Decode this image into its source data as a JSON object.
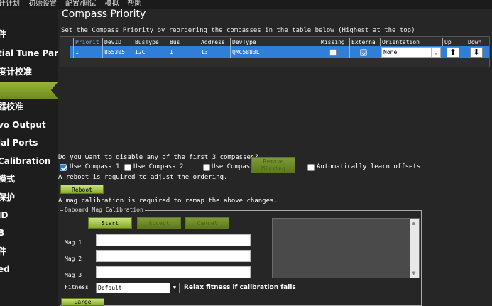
{
  "menubar": {
    "items": [
      "计计划",
      "初始设置",
      "配置/调试",
      "模拟",
      "帮助"
    ]
  },
  "sidebar": {
    "items": [
      {
        "label": "件"
      },
      {
        "label": "tial Tune Pars"
      },
      {
        "label": "度计校准"
      },
      {
        "label": ""
      },
      {
        "label": "器校准"
      },
      {
        "label": "vo Output"
      },
      {
        "label": "ial Ports"
      },
      {
        "label": "Calibration"
      },
      {
        "label": "模式"
      },
      {
        "label": "保护"
      },
      {
        "label": "ID"
      },
      {
        "label": "B"
      },
      {
        "label": "件"
      },
      {
        "label": "ed"
      }
    ]
  },
  "main": {
    "title": "Compass Priority",
    "description": "Set the Compass Priority by reordering the compasses in the table below (Highest at the top)",
    "table": {
      "headers": [
        "Priorit",
        "DevID",
        "BusType",
        "Bus",
        "Address",
        "DevType",
        "Missing",
        "Externa",
        "Orientation",
        "Up",
        "Down"
      ],
      "row": {
        "priority": "1",
        "devid": "855305",
        "bustype": "I2C",
        "bus": "1",
        "address": "13",
        "devtype": "QMC5883L",
        "missing": false,
        "external": true,
        "orientation": "None",
        "up_glyph": "⬆",
        "down_glyph": "⬇"
      }
    },
    "disable_question": "Do you want to disable any of the first 3 compasses?",
    "use_compass_1": "Use Compass 1",
    "use_compass_2": "Use Compass 2",
    "use_compass_3": "Use Compass 3",
    "remove_missing": "Remove Missing",
    "auto_learn": "Automatically learn offsets",
    "reboot_required": "A reboot is required to adjust the ordering.",
    "reboot_button": "Reboot",
    "mag_calibration_required": "A mag calibration is required to remap the above changes.",
    "onboard": {
      "title": "Onboard Mag Calibration",
      "start": "Start",
      "accept": "Accept",
      "cancel": "Cancel",
      "mag1": "Mag 1",
      "mag2": "Mag 2",
      "mag3": "Mag 3",
      "fitness_label": "Fitness",
      "fitness_value": "Default",
      "relax": "Relax fitness if calibration fails"
    },
    "large_button": "Large"
  },
  "colors": {
    "accent_green": "#8aab2d",
    "selection_blue": "#2f7ed8",
    "background": "#262626"
  }
}
